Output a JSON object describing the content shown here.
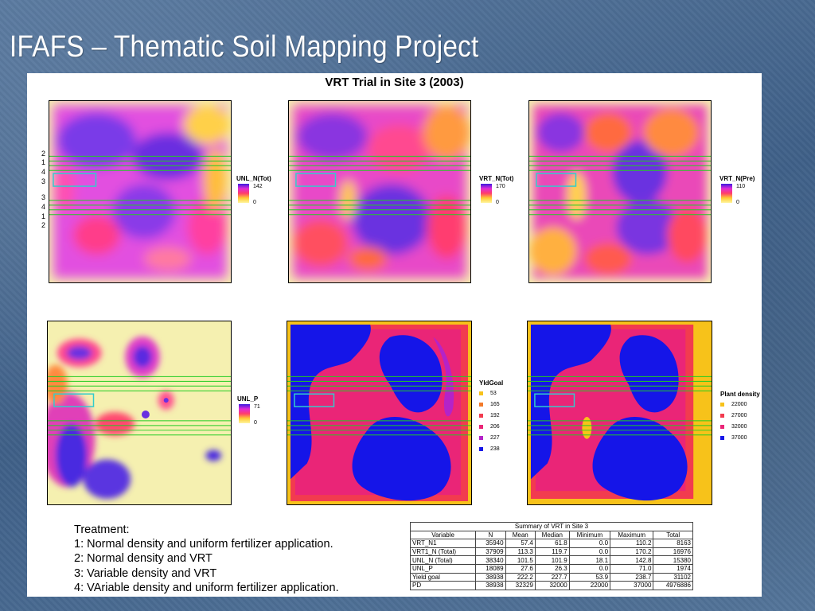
{
  "slide_title": "IFAFS – Thematic Soil Mapping Project",
  "figure_title": "VRT Trial in Site 3 (2003)",
  "strip_labels": [
    "2",
    "1",
    "4",
    "3",
    "3",
    "4",
    "1",
    "2"
  ],
  "maps": {
    "unl_n_tot": {
      "legend_title": "UNL_N(Tot)",
      "max": "142",
      "min": "0"
    },
    "vrt_n_tot": {
      "legend_title": "VRT_N(Tot)",
      "max": "170",
      "min": "0"
    },
    "vrt_n_pre": {
      "legend_title": "VRT_N(Pre)",
      "max": "110",
      "min": "0"
    },
    "unl_p": {
      "legend_title": "UNL_P",
      "max": "71",
      "min": "0"
    },
    "yldgoal": {
      "legend_title": "YldGoal",
      "items": [
        {
          "label": "53",
          "color": "#f7c21a"
        },
        {
          "label": "165",
          "color": "#f27a2a"
        },
        {
          "label": "192",
          "color": "#f23b4f"
        },
        {
          "label": "206",
          "color": "#ea2577"
        },
        {
          "label": "227",
          "color": "#b423c8"
        },
        {
          "label": "238",
          "color": "#1515e8"
        }
      ]
    },
    "plant_density": {
      "legend_title": "Plant density",
      "items": [
        {
          "label": "22000",
          "color": "#f7c21a"
        },
        {
          "label": "27000",
          "color": "#f23b4f"
        },
        {
          "label": "32000",
          "color": "#ea2577"
        },
        {
          "label": "37000",
          "color": "#1515e8"
        }
      ]
    }
  },
  "treatment": {
    "heading": "Treatment:",
    "items": [
      "1: Normal density and uniform fertilizer application.",
      "2: Normal density and VRT",
      "3: Variable density and VRT",
      "4: VAriable density and uniform fertilizer application."
    ]
  },
  "summary_table": {
    "caption": "Summary of VRT in Site 3",
    "headers": [
      "Variable",
      "N",
      "Mean",
      "Median",
      "Minimum",
      "Maximum",
      "Total"
    ],
    "rows": [
      [
        "VRT_N1",
        "35940",
        "57.4",
        "61.8",
        "0.0",
        "110.2",
        "8163"
      ],
      [
        "VRT1_N (Total)",
        "37909",
        "113.3",
        "119.7",
        "0.0",
        "170.2",
        "16976"
      ],
      [
        "UNL_N (Total)",
        "38340",
        "101.5",
        "101.9",
        "18.1",
        "142.8",
        "15380"
      ],
      [
        "UNL_P",
        "18089",
        "27.6",
        "26.3",
        "0.0",
        "71.0",
        "1974"
      ],
      [
        "Yield goal",
        "38938",
        "222.2",
        "227.7",
        "53.9",
        "238.7",
        "31102"
      ],
      [
        "PD",
        "38938",
        "32329",
        "32000",
        "22000",
        "37000",
        "4976886"
      ]
    ]
  },
  "colors": {
    "slide_background": "#4a6a90",
    "strip_lines": "#22cc22",
    "plot_marker": "#33cccc",
    "cat_yellow": "#f7c21a",
    "cat_blue": "#1515e8"
  }
}
